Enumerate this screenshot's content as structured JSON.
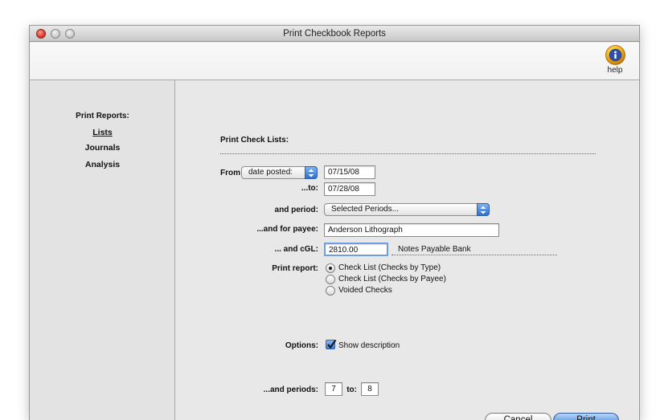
{
  "window": {
    "title": "Print Checkbook Reports"
  },
  "toolbar": {
    "help_label": "help",
    "help_icon": "info-icon"
  },
  "sidebar": {
    "title": "Print Reports:",
    "items": [
      {
        "label": "Lists",
        "active": true
      },
      {
        "label": "Journals",
        "active": false
      },
      {
        "label": "Analysis",
        "active": false
      }
    ]
  },
  "main": {
    "section_title": "Print Check Lists:",
    "from_label": "From",
    "from_select": "date posted:",
    "from_date": "07/15/08",
    "to_label": "...to:",
    "to_date": "07/28/08",
    "period_label": "and period:",
    "period_select": "Selected Periods...",
    "payee_label": "...and for payee:",
    "payee_value": "Anderson Lithograph",
    "cgl_label": "... and cGL:",
    "cgl_value": "2810.00",
    "cgl_description": "Notes Payable Bank",
    "print_report_label": "Print report:",
    "report_options": [
      {
        "label": "Check List (Checks by Type)",
        "selected": true
      },
      {
        "label": "Check List (Checks by Payee)",
        "selected": false
      },
      {
        "label": "Voided Checks",
        "selected": false
      }
    ],
    "options_label": "Options:",
    "show_description_label": "Show description",
    "show_description_checked": true,
    "periods_label": "...and periods:",
    "period_from": "7",
    "period_to_label": "to:",
    "period_to": "8"
  },
  "buttons": {
    "cancel": "Cancel",
    "print": "Print"
  }
}
